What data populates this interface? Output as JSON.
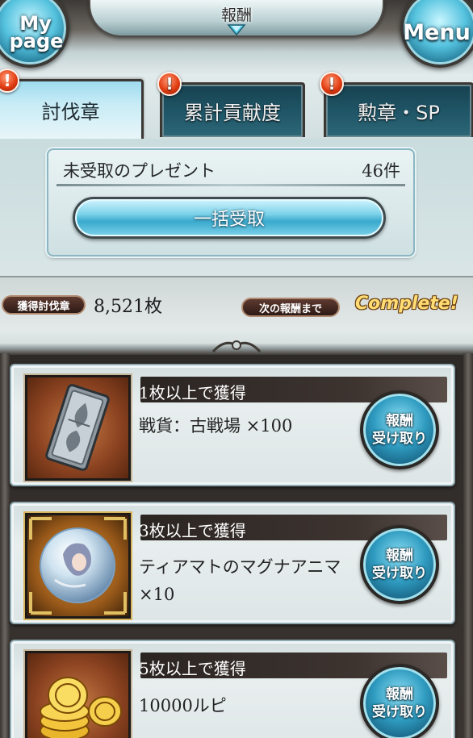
{
  "header": {
    "title": "報酬",
    "mypage_line1": "My",
    "mypage_line2": "page",
    "menu_label": "Menu"
  },
  "tabs": [
    {
      "label": "討伐章",
      "active": true,
      "alert": "!"
    },
    {
      "label": "累計貢献度",
      "active": false,
      "alert": "!"
    },
    {
      "label": "勲章・SP",
      "active": false,
      "alert": "!"
    }
  ],
  "present": {
    "label": "未受取のプレゼント",
    "count": "46件",
    "receive_all_label": "一括受取"
  },
  "stats": {
    "earned_label": "獲得討伐章",
    "earned_value": "8,521枚",
    "next_label": "次の報酬まで",
    "next_value": "Complete!"
  },
  "rewards": [
    {
      "requirement": "1枚以上で獲得",
      "item": "戦貨：古戦場 ×100",
      "item_icon": "war-coin-card-icon",
      "claim_line1": "報酬",
      "claim_line2": "受け取り"
    },
    {
      "requirement": "3枚以上で獲得",
      "item": "ティアマトのマグナアニマ ×10",
      "item_icon": "magna-anima-orb-icon",
      "claim_line1": "報酬",
      "claim_line2": "受け取り"
    },
    {
      "requirement": "5枚以上で獲得",
      "item": "10000ルピ",
      "item_icon": "rupie-coins-icon",
      "claim_line1": "報酬",
      "claim_line2": "受け取り"
    }
  ],
  "colors": {
    "tab_active": "#c8ecf6",
    "tab_inactive": "#1f5566",
    "alert_badge": "#e23d12",
    "complete_text": "#ffdd74",
    "button_blue": "#3aa9cd"
  }
}
